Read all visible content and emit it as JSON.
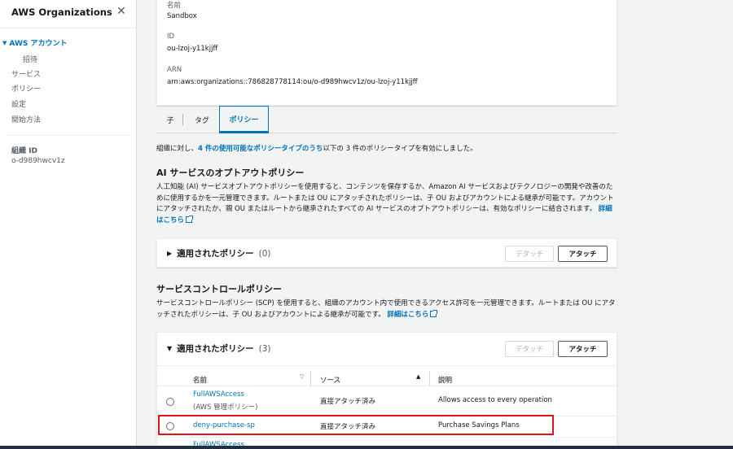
{
  "sidebar": {
    "title": "AWS Organizations",
    "section": "AWS アカウント",
    "items": [
      "招待",
      "サービス",
      "ポリシー",
      "設定",
      "開始方法"
    ],
    "org_id_label": "組織 ID",
    "org_id_value": "o-d989hwcv1z"
  },
  "details": {
    "name_label": "名前",
    "name_value": "Sandbox",
    "id_label": "ID",
    "id_value": "ou-lzoj-y11kjjff",
    "arn_label": "ARN",
    "arn_value": "arn:aws:organizations::786828778114:ou/o-d989hwcv1z/ou-lzoj-y11kjjff"
  },
  "tabs": [
    "子",
    "タグ",
    "ポリシー"
  ],
  "intro": {
    "prefix": "組織に対し、",
    "link": "4 件の使用可能なポリシータイプのうち",
    "suffix": "以下の 3 件のポリシータイプを有効にしました。"
  },
  "ai_section": {
    "heading": "AI サービスのオプトアウトポリシー",
    "text": "人工知能 (AI) サービスオプトアウトポリシーを使用すると、コンテンツを保存するか、Amazon AI サービスおよびテクノロジーの開発や改善のために使用するかを一元管理できます。ルートまたは OU にアタッチされたポリシーは、子 OU およびアカウントによる継承が可能です。アカウントにアタッチされたか、親 OU またはルートから継承されたすべての AI サービスのオプトアウトポリシーは、有効なポリシーに結合されます。",
    "link": "詳細はこちら",
    "panel_title": "適用されたポリシー",
    "panel_count": "(0)",
    "detach": "デタッチ",
    "attach": "アタッチ"
  },
  "scp_section": {
    "heading": "サービスコントロールポリシー",
    "text": "サービスコントロールポリシー (SCP) を使用すると、組織のアカウント内で使用できるアクセス許可を一元管理できます。ルートまたは OU にアタッチされたポリシーは、子 OU およびアカウントによる継承が可能です。",
    "link": "詳細はこちら",
    "panel_title": "適用されたポリシー",
    "panel_count": "(3)",
    "detach": "デタッチ",
    "attach": "アタッチ",
    "columns": [
      "名前",
      "ソース",
      "説明"
    ],
    "rows": [
      {
        "name": "FullAWSAccess",
        "sub": "(AWS 管理ポリシー)",
        "source": "直接アタッチ済み",
        "desc": "Allows access to every operation"
      },
      {
        "name": "deny-purchase-sp",
        "sub": "",
        "source": "直接アタッチ済み",
        "desc": "Purchase Savings Plans"
      },
      {
        "name": "FullAWSAccess",
        "sub": "",
        "source": "",
        "desc": ""
      }
    ]
  },
  "colors": {
    "link": "#0073bb",
    "highlight": "#e5121a",
    "background": "#f2f3f3"
  }
}
